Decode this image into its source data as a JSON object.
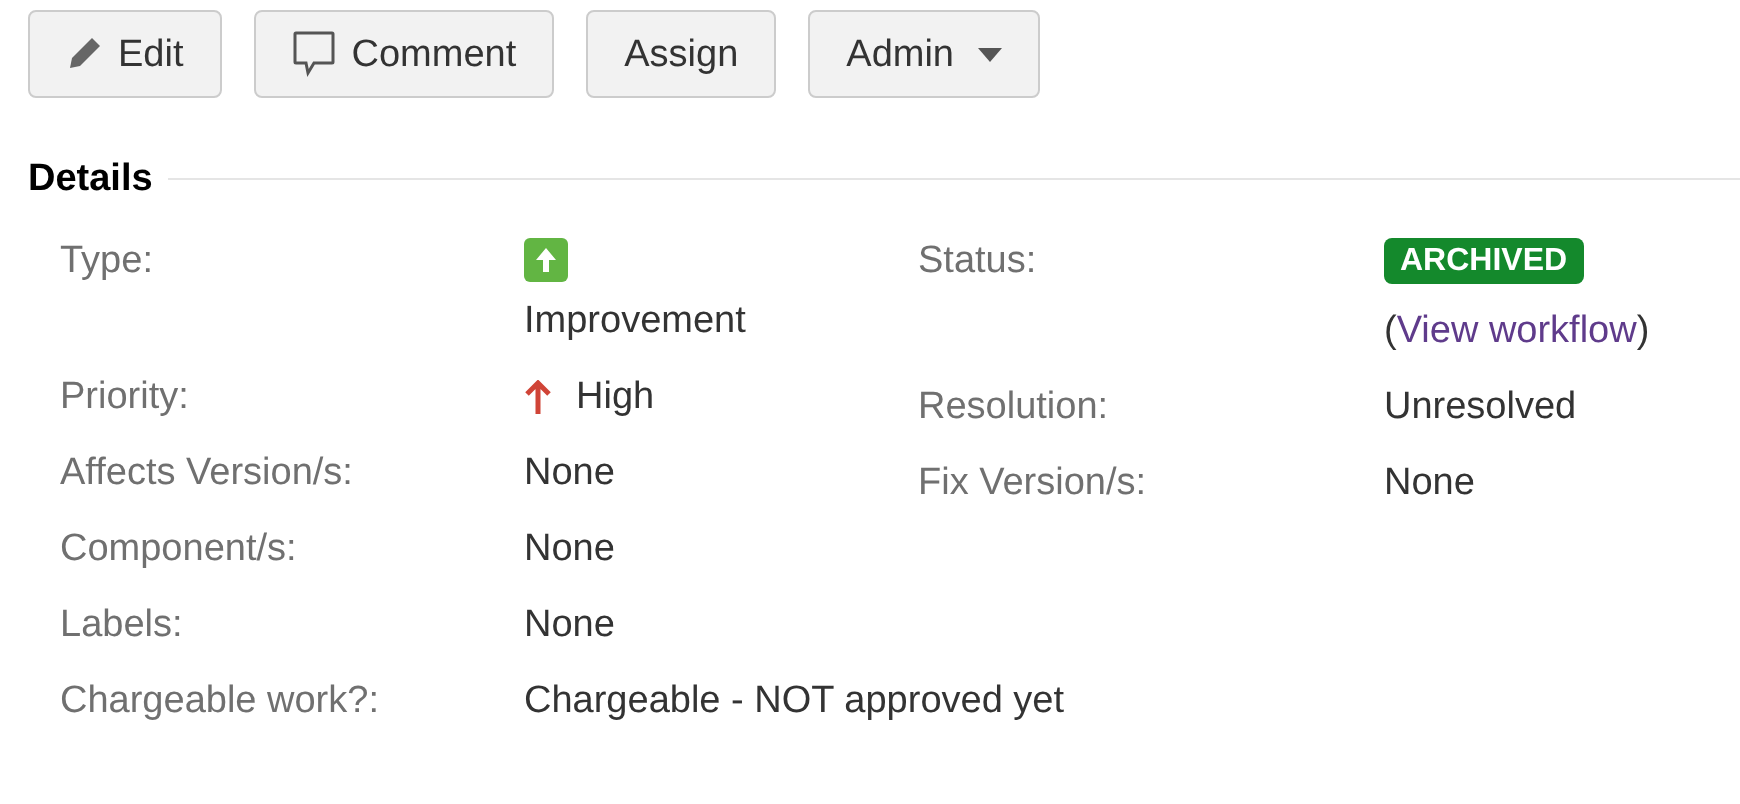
{
  "toolbar": [
    {
      "label": "Edit",
      "kind": "edit",
      "dropdown": false
    },
    {
      "label": "Comment",
      "kind": "comment",
      "dropdown": false
    },
    {
      "label": "Assign",
      "kind": "plain",
      "dropdown": false
    },
    {
      "label": "Admin",
      "kind": "plain",
      "dropdown": true
    }
  ],
  "details": {
    "title": "Details",
    "left": [
      {
        "label": "Type:",
        "kind": "type",
        "value": "Improvement"
      },
      {
        "label": "Priority:",
        "kind": "priority",
        "value": "High"
      },
      {
        "label": "Affects Version/s:",
        "kind": "text",
        "value": "None"
      },
      {
        "label": "Component/s:",
        "kind": "text",
        "value": "None"
      },
      {
        "label": "Labels:",
        "kind": "text",
        "value": "None"
      },
      {
        "label": "Chargeable work?:",
        "kind": "text",
        "value": "Chargeable - NOT approved yet"
      }
    ],
    "right": [
      {
        "label": "Status:",
        "kind": "status",
        "value": "ARCHIVED",
        "color": "#14892c",
        "link_open": "(",
        "link": "View workflow",
        "link_close": ")"
      },
      {
        "label": "Resolution:",
        "kind": "text",
        "value": "Unresolved"
      },
      {
        "label": "Fix Version/s:",
        "kind": "text",
        "value": "None"
      }
    ]
  }
}
